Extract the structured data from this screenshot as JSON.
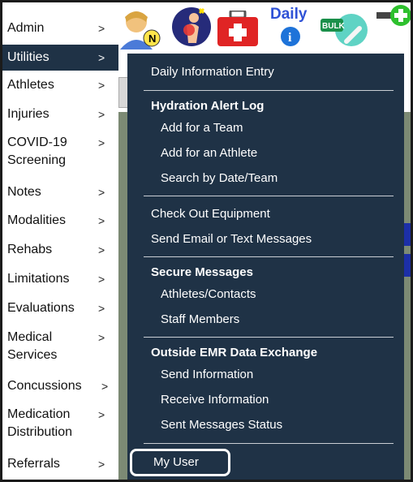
{
  "sidebar": {
    "items": [
      {
        "label": "Admin",
        "chevron": ">"
      },
      {
        "label": "Utilities",
        "chevron": ">"
      },
      {
        "label": "Athletes",
        "chevron": ">"
      },
      {
        "label": "Injuries",
        "chevron": ">"
      },
      {
        "label": "COVID-19",
        "label2": "Screening",
        "chevron": ">"
      },
      {
        "label": "Notes",
        "chevron": ">"
      },
      {
        "label": "Modalities",
        "chevron": ">"
      },
      {
        "label": "Rehabs",
        "chevron": ">"
      },
      {
        "label": "Limitations",
        "chevron": ">"
      },
      {
        "label": "Evaluations",
        "chevron": ">"
      },
      {
        "label": "Medical",
        "label2": "Services",
        "chevron": ">"
      },
      {
        "label": "Concussions",
        "chevron": ">"
      },
      {
        "label": "Medication",
        "label2": "Distribution",
        "chevron": ">"
      },
      {
        "label": "Referrals",
        "chevron": ">"
      }
    ]
  },
  "toolbar": {
    "daily_label": "Daily",
    "bulk_label": "BULK",
    "icons": [
      "user-n-icon",
      "injury-icon",
      "first-aid-kit-icon",
      "daily-info-icon",
      "bulk-entry-icon",
      "hydration-icon"
    ]
  },
  "menu": {
    "daily_info": "Daily Information Entry",
    "hydration": {
      "title": "Hydration Alert Log",
      "items": [
        "Add for a Team",
        "Add for an Athlete",
        "Search by Date/Team"
      ]
    },
    "check_out": "Check Out Equipment",
    "send_email": "Send Email or Text Messages",
    "secure": {
      "title": "Secure Messages",
      "items": [
        "Athletes/Contacts",
        "Staff Members"
      ]
    },
    "emr": {
      "title": "Outside EMR Data Exchange",
      "items": [
        "Send Information",
        "Receive Information",
        "Sent Messages Status"
      ]
    },
    "my_user": "My User"
  },
  "colors": {
    "sidebar_active": "#1f3246",
    "menu_bg": "#1f3246"
  }
}
